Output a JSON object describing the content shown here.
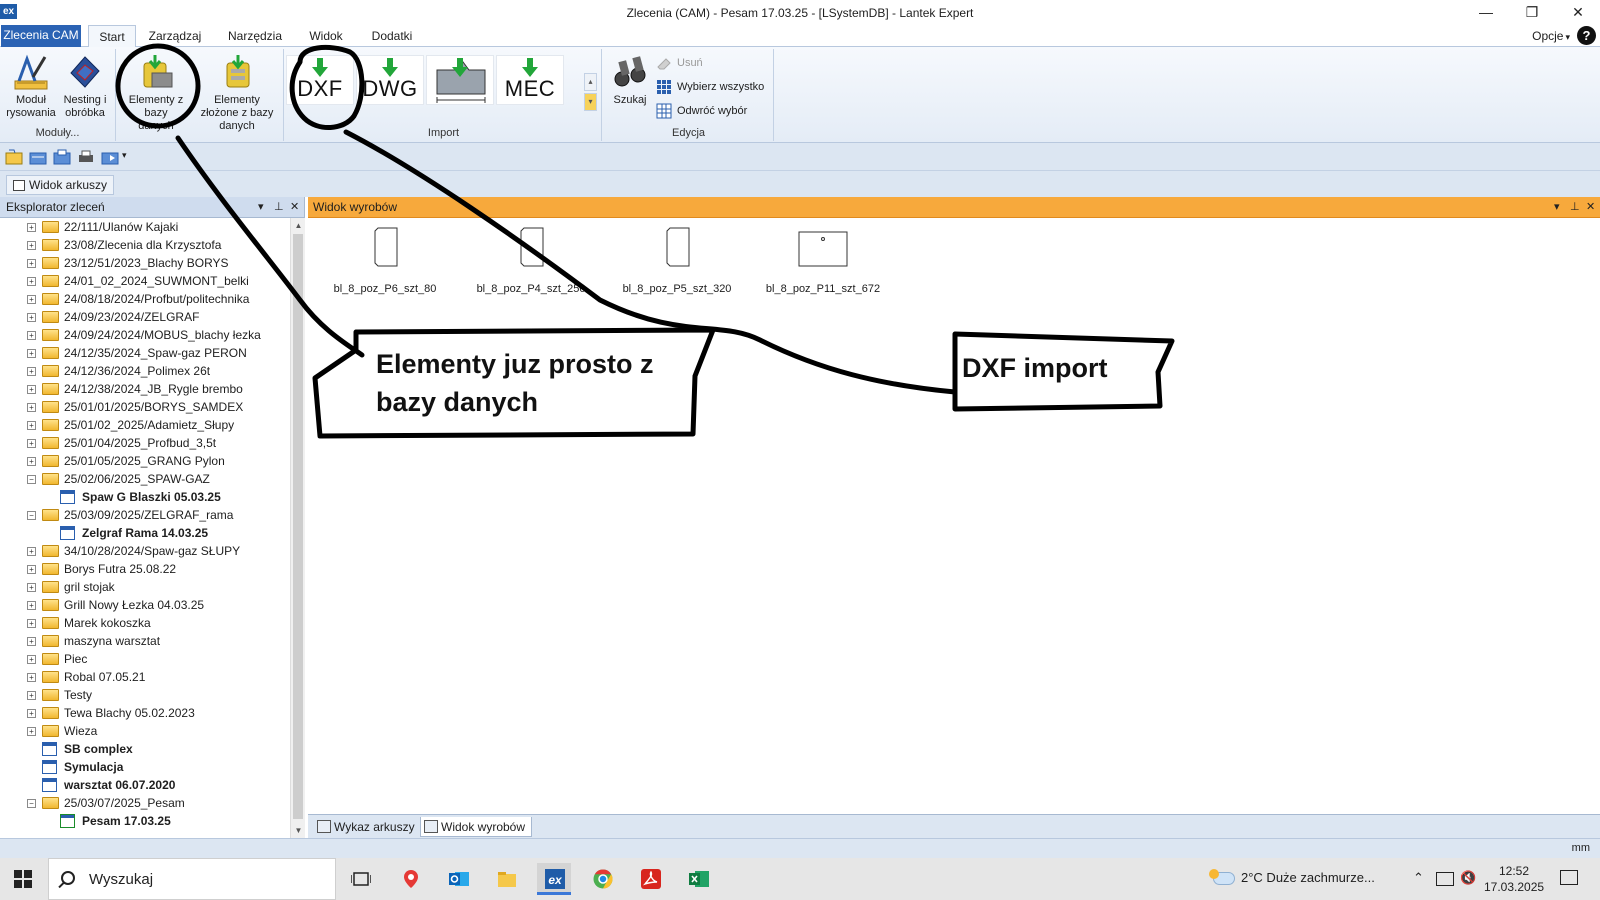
{
  "window": {
    "title": "Zlecenia (CAM) - Pesam 17.03.25 - [LSystemDB] - Lantek Expert",
    "logo": "ex",
    "minimize": "—",
    "maximize": "❐",
    "close": "✕"
  },
  "ribbon_tabs": {
    "file": "Zlecenia CAM",
    "tabs": [
      "Start",
      "Zarządzaj",
      "Narzędzia",
      "Widok",
      "Dodatki"
    ],
    "options": "Opcje",
    "options_arrow": "▾",
    "help": "?"
  },
  "ribbon": {
    "modules_group": "Moduły...",
    "modul_label": "Moduł rysowania",
    "nesting_label": "Nesting i obróbka",
    "elementy_label": "Elementy z bazy danych",
    "zlozone_label": "Elementy złożone z bazy danych",
    "import_group": "Import",
    "import_formats": [
      "DXF",
      "DWG",
      "",
      "MEC"
    ],
    "scroll_up": "▴",
    "scroll_down": "▾",
    "szukaj_label": "Szukaj",
    "edit_group": "Edycja",
    "usun": "Usuń",
    "wybierz": "Wybierz wszystko",
    "odwroc": "Odwróć wybór"
  },
  "qat": {
    "dropdown_arrow": "▾"
  },
  "sheet_view_button": "Widok arkuszy",
  "left_panel": {
    "title": "Eksplorator zleceń",
    "controls": [
      "▾",
      "⊥",
      "✕"
    ],
    "expand_plus": "+",
    "expand_minus": "−",
    "scroll_up": "▲",
    "scroll_down": "▼",
    "items": [
      {
        "label": "22/111/Ulanów Kajaki",
        "type": "folder",
        "level": 0,
        "bold": false,
        "expander": "+"
      },
      {
        "label": "23/08/Zlecenia dla Krzysztofa",
        "type": "folder",
        "level": 0,
        "bold": false,
        "expander": "+"
      },
      {
        "label": "23/12/51/2023_Blachy BORYS",
        "type": "folder",
        "level": 0,
        "bold": false,
        "expander": "+"
      },
      {
        "label": "24/01_02_2024_SUWMONT_belki",
        "type": "folder",
        "level": 0,
        "bold": false,
        "expander": "+"
      },
      {
        "label": "24/08/18/2024/Profbut/politechnika",
        "type": "folder",
        "level": 0,
        "bold": false,
        "expander": "+"
      },
      {
        "label": "24/09/23/2024/ZELGRAF",
        "type": "folder",
        "level": 0,
        "bold": false,
        "expander": "+"
      },
      {
        "label": "24/09/24/2024/MOBUS_blachy łezka",
        "type": "folder",
        "level": 0,
        "bold": false,
        "expander": "+"
      },
      {
        "label": "24/12/35/2024_Spaw-gaz PERON",
        "type": "folder",
        "level": 0,
        "bold": false,
        "expander": "+"
      },
      {
        "label": "24/12/36/2024_Polimex 26t",
        "type": "folder",
        "level": 0,
        "bold": false,
        "expander": "+"
      },
      {
        "label": "24/12/38/2024_JB_Rygle brembo",
        "type": "folder",
        "level": 0,
        "bold": false,
        "expander": "+"
      },
      {
        "label": "25/01/01/2025/BORYS_SAMDEX",
        "type": "folder",
        "level": 0,
        "bold": false,
        "expander": "+"
      },
      {
        "label": "25/01/02_2025/Adamietz_Słupy",
        "type": "folder",
        "level": 0,
        "bold": false,
        "expander": "+"
      },
      {
        "label": "25/01/04/2025_Profbud_3,5t",
        "type": "folder",
        "level": 0,
        "bold": false,
        "expander": "+"
      },
      {
        "label": "25/01/05/2025_GRANG Pylon",
        "type": "folder",
        "level": 0,
        "bold": false,
        "expander": "+"
      },
      {
        "label": "25/02/06/2025_SPAW-GAZ",
        "type": "folder",
        "level": 0,
        "bold": false,
        "expander": "−"
      },
      {
        "label": "Spaw G Blaszki 05.03.25",
        "type": "job",
        "level": 1,
        "bold": true,
        "expander": ""
      },
      {
        "label": "25/03/09/2025/ZELGRAF_rama",
        "type": "folder",
        "level": 0,
        "bold": false,
        "expander": "−"
      },
      {
        "label": "Zelgraf Rama 14.03.25",
        "type": "job",
        "level": 1,
        "bold": true,
        "expander": ""
      },
      {
        "label": "34/10/28/2024/Spaw-gaz SŁUPY",
        "type": "folder",
        "level": 0,
        "bold": false,
        "expander": "+"
      },
      {
        "label": "Borys Futra 25.08.22",
        "type": "folder",
        "level": 0,
        "bold": false,
        "expander": "+"
      },
      {
        "label": "gril stojak",
        "type": "folder",
        "level": 0,
        "bold": false,
        "expander": "+"
      },
      {
        "label": "Grill Nowy Łezka 04.03.25",
        "type": "folder",
        "level": 0,
        "bold": false,
        "expander": "+"
      },
      {
        "label": "Marek kokoszka",
        "type": "folder",
        "level": 0,
        "bold": false,
        "expander": "+"
      },
      {
        "label": "maszyna warsztat",
        "type": "folder",
        "level": 0,
        "bold": false,
        "expander": "+"
      },
      {
        "label": "Piec",
        "type": "folder",
        "level": 0,
        "bold": false,
        "expander": "+"
      },
      {
        "label": "Robal 07.05.21",
        "type": "folder",
        "level": 0,
        "bold": false,
        "expander": "+"
      },
      {
        "label": "Testy",
        "type": "folder",
        "level": 0,
        "bold": false,
        "expander": "+"
      },
      {
        "label": "Tewa Blachy 05.02.2023",
        "type": "folder",
        "level": 0,
        "bold": false,
        "expander": "+"
      },
      {
        "label": "Wieza",
        "type": "folder",
        "level": 0,
        "bold": false,
        "expander": "+"
      },
      {
        "label": "SB complex",
        "type": "job",
        "level": 0,
        "bold": true,
        "expander": ""
      },
      {
        "label": "Symulacja",
        "type": "job",
        "level": 0,
        "bold": true,
        "expander": ""
      },
      {
        "label": "warsztat 06.07.2020",
        "type": "job",
        "level": 0,
        "bold": true,
        "expander": ""
      },
      {
        "label": "25/03/07/2025_Pesam",
        "type": "folder",
        "level": 0,
        "bold": false,
        "expander": "−"
      },
      {
        "label": "Pesam 17.03.25",
        "type": "job-checked",
        "level": 1,
        "bold": true,
        "expander": ""
      }
    ]
  },
  "right_panel": {
    "title": "Widok wyrobów",
    "controls": [
      "▾",
      "⊥",
      "✕"
    ],
    "parts": [
      {
        "label": "bl_8_poz_P6_szt_80"
      },
      {
        "label": "bl_8_poz_P4_szt_256"
      },
      {
        "label": "bl_8_poz_P5_szt_320"
      },
      {
        "label": "bl_8_poz_P11_szt_672"
      }
    ],
    "bottom_tabs": [
      "Wykaz arkuszy",
      "Widok wyrobów"
    ]
  },
  "status": {
    "unit": "mm"
  },
  "taskbar": {
    "search_placeholder": "Wyszukaj",
    "weather": "2°C  Duże zachmurze...",
    "chevron": "⌃",
    "speaker": "🔇",
    "time": "12:52",
    "date": "17.03.2025"
  },
  "annotations": {
    "callout1_line1": "Elementy  juz  prosto z",
    "callout1_line2": "bazy danych",
    "callout2": "DXF  import"
  },
  "colors": {
    "file_tab": "#2b63b4",
    "panel_orange": "#f7a93c",
    "ribbon_bg": "#e4ecf6",
    "import_arrow": "#22a63a"
  }
}
